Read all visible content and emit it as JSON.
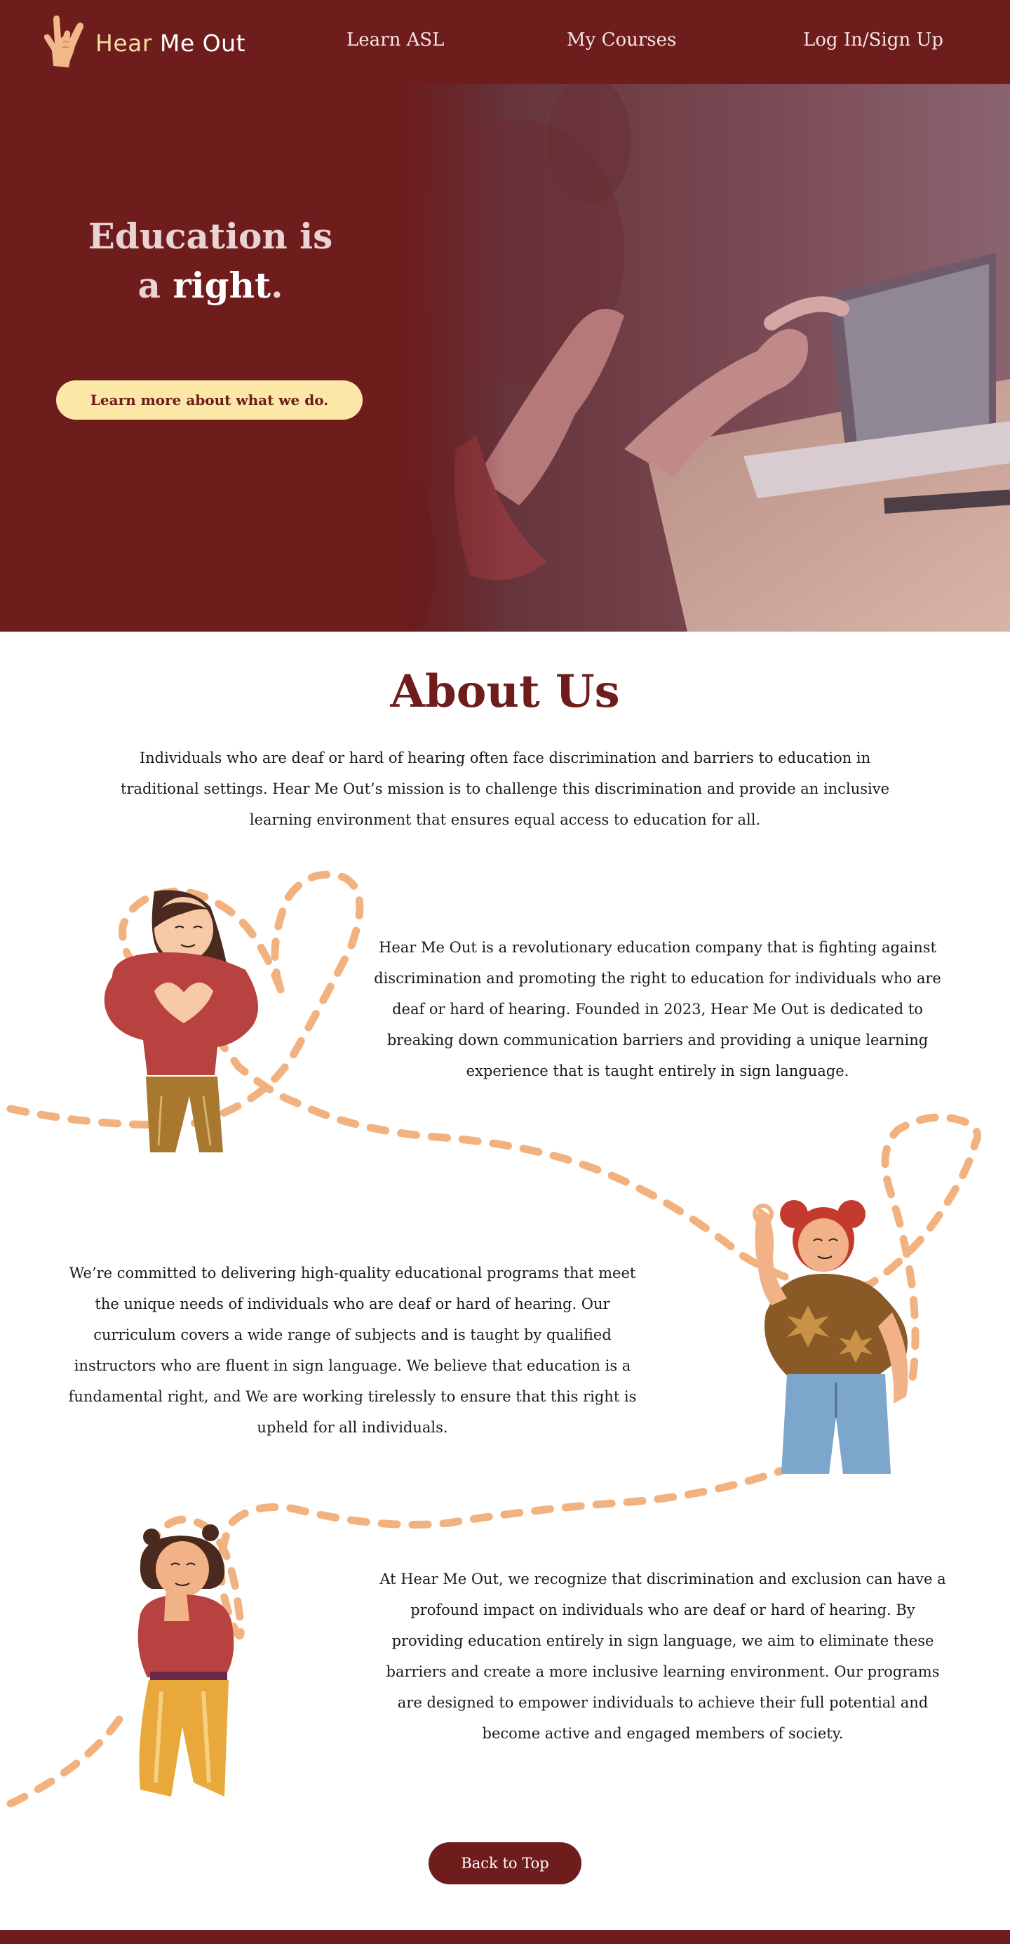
{
  "nav": {
    "logo_hear": "Hear",
    "logo_rest": " Me Out",
    "links": [
      "Learn ASL",
      "My Courses",
      "Log In/Sign Up"
    ]
  },
  "hero": {
    "title_line1": "Education is",
    "title_a": "a ",
    "title_right": "right",
    "title_period": ".",
    "cta": "Learn more about what we do."
  },
  "about": {
    "title": "About Us",
    "intro": "Individuals who are deaf or hard of hearing often face discrimination and barriers to education in traditional settings. Hear Me Out’s mission is to challenge this discrimination and provide an inclusive learning environment that ensures equal access to education for all.",
    "paragraph1": "Hear Me Out is a revolutionary education company that is fighting against discrimination and promoting the right to education for individuals who are deaf or hard of hearing. Founded in 2023, Hear Me Out is dedicated to breaking down communication barriers and providing a unique learning experience that is taught entirely in sign language.",
    "paragraph2": "We’re committed to delivering high-quality educational programs that meet the unique needs of individuals who are deaf or hard of hearing. Our curriculum covers a wide range of subjects and is taught by qualified instructors who are fluent in sign language. We believe that education is a fundamental right, and We are working tirelessly to ensure that this right is upheld for all individuals.",
    "paragraph3": "At Hear Me Out, we recognize that discrimination and exclusion can have a profound impact on individuals who are deaf or hard of hearing. By providing education entirely in sign language, we aim to eliminate these barriers and create a more inclusive learning environment. Our programs are designed to empower individuals to achieve their full potential and become active and engaged members of society."
  },
  "back_to_top": "Back to Top",
  "icons": {
    "logo": "ily-hand-sign-icon"
  },
  "colors": {
    "brand": "#6e1c1c",
    "cta": "#fbe8a6",
    "dash": "#f2b27f"
  }
}
